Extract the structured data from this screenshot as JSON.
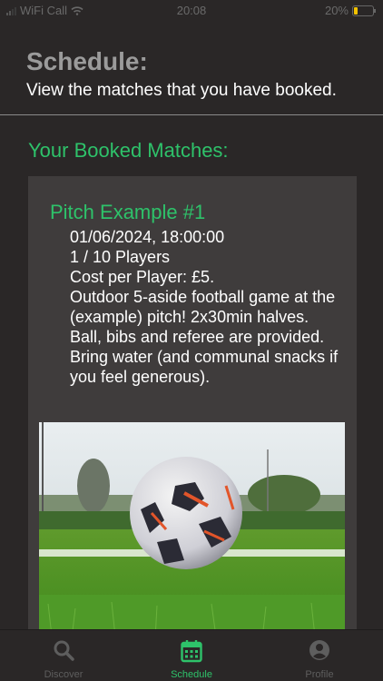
{
  "status_bar": {
    "carrier": "WiFi Call",
    "time": "20:08",
    "battery": "20%",
    "battery_level": 0.2
  },
  "header": {
    "title": "Schedule:",
    "subtitle": "View the matches that you have booked."
  },
  "booked": {
    "heading": "Your Booked Matches:",
    "matches": [
      {
        "title": "Pitch Example #1",
        "datetime": "01/06/2024, 18:00:00",
        "players": "1 / 10 Players",
        "cost": "Cost per Player: £5.",
        "description": "Outdoor 5-aside football game at the (example) pitch! 2x30min halves. Ball, bibs and referee are provided. Bring water (and communal snacks if you feel generous)."
      }
    ]
  },
  "tabs": [
    {
      "label": "Discover",
      "icon": "search-icon",
      "active": false
    },
    {
      "label": "Schedule",
      "icon": "calendar-icon",
      "active": true
    },
    {
      "label": "Profile",
      "icon": "user-circle-icon",
      "active": false
    }
  ],
  "colors": {
    "background": "#2a2727",
    "card": "#3f3c3c",
    "accent": "#2ec26a",
    "muted": "#5e5e5e"
  }
}
